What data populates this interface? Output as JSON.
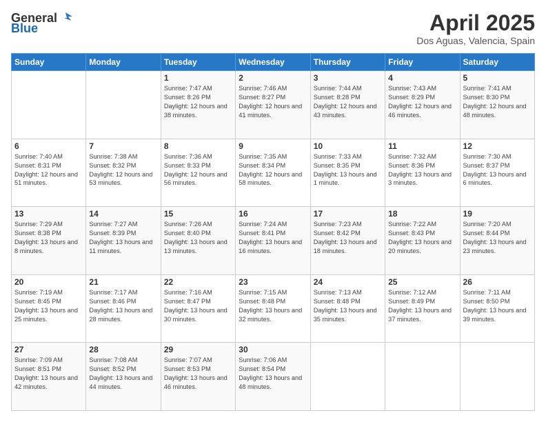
{
  "header": {
    "logo_general": "General",
    "logo_blue": "Blue",
    "month_title": "April 2025",
    "location": "Dos Aguas, Valencia, Spain"
  },
  "weekdays": [
    "Sunday",
    "Monday",
    "Tuesday",
    "Wednesday",
    "Thursday",
    "Friday",
    "Saturday"
  ],
  "weeks": [
    [
      {
        "day": "",
        "sunrise": "",
        "sunset": "",
        "daylight": ""
      },
      {
        "day": "",
        "sunrise": "",
        "sunset": "",
        "daylight": ""
      },
      {
        "day": "1",
        "sunrise": "Sunrise: 7:47 AM",
        "sunset": "Sunset: 8:26 PM",
        "daylight": "Daylight: 12 hours and 38 minutes."
      },
      {
        "day": "2",
        "sunrise": "Sunrise: 7:46 AM",
        "sunset": "Sunset: 8:27 PM",
        "daylight": "Daylight: 12 hours and 41 minutes."
      },
      {
        "day": "3",
        "sunrise": "Sunrise: 7:44 AM",
        "sunset": "Sunset: 8:28 PM",
        "daylight": "Daylight: 12 hours and 43 minutes."
      },
      {
        "day": "4",
        "sunrise": "Sunrise: 7:43 AM",
        "sunset": "Sunset: 8:29 PM",
        "daylight": "Daylight: 12 hours and 46 minutes."
      },
      {
        "day": "5",
        "sunrise": "Sunrise: 7:41 AM",
        "sunset": "Sunset: 8:30 PM",
        "daylight": "Daylight: 12 hours and 48 minutes."
      }
    ],
    [
      {
        "day": "6",
        "sunrise": "Sunrise: 7:40 AM",
        "sunset": "Sunset: 8:31 PM",
        "daylight": "Daylight: 12 hours and 51 minutes."
      },
      {
        "day": "7",
        "sunrise": "Sunrise: 7:38 AM",
        "sunset": "Sunset: 8:32 PM",
        "daylight": "Daylight: 12 hours and 53 minutes."
      },
      {
        "day": "8",
        "sunrise": "Sunrise: 7:36 AM",
        "sunset": "Sunset: 8:33 PM",
        "daylight": "Daylight: 12 hours and 56 minutes."
      },
      {
        "day": "9",
        "sunrise": "Sunrise: 7:35 AM",
        "sunset": "Sunset: 8:34 PM",
        "daylight": "Daylight: 12 hours and 58 minutes."
      },
      {
        "day": "10",
        "sunrise": "Sunrise: 7:33 AM",
        "sunset": "Sunset: 8:35 PM",
        "daylight": "Daylight: 13 hours and 1 minute."
      },
      {
        "day": "11",
        "sunrise": "Sunrise: 7:32 AM",
        "sunset": "Sunset: 8:36 PM",
        "daylight": "Daylight: 13 hours and 3 minutes."
      },
      {
        "day": "12",
        "sunrise": "Sunrise: 7:30 AM",
        "sunset": "Sunset: 8:37 PM",
        "daylight": "Daylight: 13 hours and 6 minutes."
      }
    ],
    [
      {
        "day": "13",
        "sunrise": "Sunrise: 7:29 AM",
        "sunset": "Sunset: 8:38 PM",
        "daylight": "Daylight: 13 hours and 8 minutes."
      },
      {
        "day": "14",
        "sunrise": "Sunrise: 7:27 AM",
        "sunset": "Sunset: 8:39 PM",
        "daylight": "Daylight: 13 hours and 11 minutes."
      },
      {
        "day": "15",
        "sunrise": "Sunrise: 7:26 AM",
        "sunset": "Sunset: 8:40 PM",
        "daylight": "Daylight: 13 hours and 13 minutes."
      },
      {
        "day": "16",
        "sunrise": "Sunrise: 7:24 AM",
        "sunset": "Sunset: 8:41 PM",
        "daylight": "Daylight: 13 hours and 16 minutes."
      },
      {
        "day": "17",
        "sunrise": "Sunrise: 7:23 AM",
        "sunset": "Sunset: 8:42 PM",
        "daylight": "Daylight: 13 hours and 18 minutes."
      },
      {
        "day": "18",
        "sunrise": "Sunrise: 7:22 AM",
        "sunset": "Sunset: 8:43 PM",
        "daylight": "Daylight: 13 hours and 20 minutes."
      },
      {
        "day": "19",
        "sunrise": "Sunrise: 7:20 AM",
        "sunset": "Sunset: 8:44 PM",
        "daylight": "Daylight: 13 hours and 23 minutes."
      }
    ],
    [
      {
        "day": "20",
        "sunrise": "Sunrise: 7:19 AM",
        "sunset": "Sunset: 8:45 PM",
        "daylight": "Daylight: 13 hours and 25 minutes."
      },
      {
        "day": "21",
        "sunrise": "Sunrise: 7:17 AM",
        "sunset": "Sunset: 8:46 PM",
        "daylight": "Daylight: 13 hours and 28 minutes."
      },
      {
        "day": "22",
        "sunrise": "Sunrise: 7:16 AM",
        "sunset": "Sunset: 8:47 PM",
        "daylight": "Daylight: 13 hours and 30 minutes."
      },
      {
        "day": "23",
        "sunrise": "Sunrise: 7:15 AM",
        "sunset": "Sunset: 8:48 PM",
        "daylight": "Daylight: 13 hours and 32 minutes."
      },
      {
        "day": "24",
        "sunrise": "Sunrise: 7:13 AM",
        "sunset": "Sunset: 8:48 PM",
        "daylight": "Daylight: 13 hours and 35 minutes."
      },
      {
        "day": "25",
        "sunrise": "Sunrise: 7:12 AM",
        "sunset": "Sunset: 8:49 PM",
        "daylight": "Daylight: 13 hours and 37 minutes."
      },
      {
        "day": "26",
        "sunrise": "Sunrise: 7:11 AM",
        "sunset": "Sunset: 8:50 PM",
        "daylight": "Daylight: 13 hours and 39 minutes."
      }
    ],
    [
      {
        "day": "27",
        "sunrise": "Sunrise: 7:09 AM",
        "sunset": "Sunset: 8:51 PM",
        "daylight": "Daylight: 13 hours and 42 minutes."
      },
      {
        "day": "28",
        "sunrise": "Sunrise: 7:08 AM",
        "sunset": "Sunset: 8:52 PM",
        "daylight": "Daylight: 13 hours and 44 minutes."
      },
      {
        "day": "29",
        "sunrise": "Sunrise: 7:07 AM",
        "sunset": "Sunset: 8:53 PM",
        "daylight": "Daylight: 13 hours and 46 minutes."
      },
      {
        "day": "30",
        "sunrise": "Sunrise: 7:06 AM",
        "sunset": "Sunset: 8:54 PM",
        "daylight": "Daylight: 13 hours and 48 minutes."
      },
      {
        "day": "",
        "sunrise": "",
        "sunset": "",
        "daylight": ""
      },
      {
        "day": "",
        "sunrise": "",
        "sunset": "",
        "daylight": ""
      },
      {
        "day": "",
        "sunrise": "",
        "sunset": "",
        "daylight": ""
      }
    ]
  ]
}
